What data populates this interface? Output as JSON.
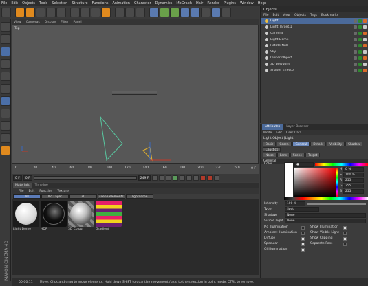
{
  "menubar": [
    "File",
    "Edit",
    "Objects",
    "Tools",
    "Selection",
    "Structure",
    "Functions",
    "Animation",
    "Character",
    "Dynamics",
    "MoGraph",
    "Hair",
    "Render",
    "Plugins",
    "Window",
    "Help"
  ],
  "viewport": {
    "menu": [
      "View",
      "Cameras",
      "Display",
      "Filter",
      "Panel"
    ],
    "label": "Top"
  },
  "timeline": {
    "ticks": [
      "0",
      "20",
      "40",
      "60",
      "80",
      "100",
      "120",
      "140",
      "160",
      "180",
      "200",
      "220",
      "240"
    ],
    "end_frame": "0 F",
    "current_frame": "0 F",
    "start_field": "0 F",
    "end_field": "249 F"
  },
  "materials": {
    "tabs": [
      "Materials",
      "Timeline"
    ],
    "menu": [
      "File",
      "Edit",
      "Function",
      "Texture"
    ],
    "layers": [
      "All",
      "No Layer",
      "3D",
      "scene elements",
      "lightdome"
    ],
    "items": [
      {
        "name": "Light Dome",
        "kind": "white"
      },
      {
        "name": "HDR",
        "kind": "hdr"
      },
      {
        "name": "3D Colour",
        "kind": "chrome"
      },
      {
        "name": "Gradient",
        "kind": "stripes"
      }
    ]
  },
  "status": {
    "time": "00:00:11",
    "message": "Move: Click and drag to move elements. Hold down SHIFT to quantize movement / add to the selection in point mode, CTRL to remove."
  },
  "objects": {
    "title": "Objects",
    "menu": [
      "File",
      "Edit",
      "View",
      "Objects",
      "Tags",
      "Bookmarks"
    ],
    "rows": [
      {
        "name": "Light",
        "selected": true,
        "color": "#f0c040"
      },
      {
        "name": "Light.Target.1",
        "selected": false,
        "color": "#cfcfcf"
      },
      {
        "name": "Camera",
        "selected": false,
        "color": "#cfcfcf"
      },
      {
        "name": "Light Dome",
        "selected": false,
        "color": "#cfcfcf"
      },
      {
        "name": "Rotate Null",
        "selected": false,
        "color": "#cfcfcf"
      },
      {
        "name": "Sky",
        "selected": false,
        "color": "#cfcfcf"
      },
      {
        "name": "Cloner Object",
        "selected": false,
        "color": "#cfcfcf"
      },
      {
        "name": "3D polygons",
        "selected": false,
        "color": "#cfcfcf"
      },
      {
        "name": "Shader Effector",
        "selected": false,
        "color": "#cfcfcf"
      }
    ]
  },
  "attributes": {
    "tabs": [
      "Attributes",
      "Layer Browser"
    ],
    "menu": [
      "Mode",
      "Edit",
      "User Data"
    ],
    "title": "Light Object [Light]",
    "subtabs_row1": [
      "Basic",
      "Coord.",
      "General",
      "Details",
      "Visibility",
      "Shadow",
      "Caustics"
    ],
    "subtabs_row2": [
      "Noise",
      "Lens",
      "Scene",
      "Target"
    ],
    "section": "General",
    "color_label": "Color",
    "hsv": {
      "H": "0 %",
      "S": "100 %",
      "V": "255"
    },
    "rgb": {
      "R": "255",
      "G": "255",
      "B": "255"
    },
    "intensity_label": "Intensity",
    "intensity_value": "100 %",
    "type_label": "Type",
    "type_value": "Spot",
    "shadow_label": "Shadow",
    "shadow_value": "None",
    "visible_light_label": "Visible Light",
    "visible_light_value": "None",
    "checks_left": [
      "No Illumination",
      "Ambient Illumination",
      "Diffuse",
      "Specular",
      "GI Illumination"
    ],
    "checks_right": [
      "Show Illumination",
      "Show Visible Light",
      "Show Clipping",
      "Separate Pass"
    ],
    "checks_left_state": [
      false,
      false,
      true,
      true,
      true
    ],
    "checks_right_state": [
      true,
      false,
      true,
      false
    ]
  },
  "colors": {
    "accent": "#e08a1e",
    "selection": "#4b6a9a",
    "viewport_bg": "#575757"
  }
}
